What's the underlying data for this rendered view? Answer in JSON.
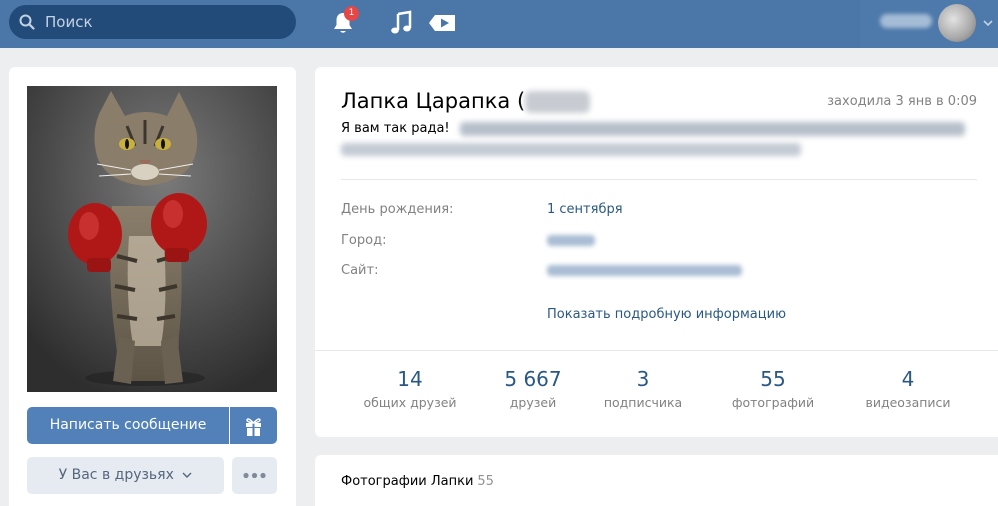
{
  "header": {
    "search_placeholder": "Поиск",
    "notifications_count": "1",
    "icons": [
      "search-icon",
      "bell-icon",
      "music-icon",
      "video-icon",
      "chevron-down-icon"
    ],
    "accent": "#4a76a8"
  },
  "profile": {
    "name": "Лапка Царапка (",
    "last_seen": "заходила 3 янв в 0:09",
    "status": "Я вам так рада! ",
    "info": {
      "birthday_label": "День рождения:",
      "birthday_value": "1 сентября",
      "city_label": "Город:",
      "site_label": "Сайт:",
      "show_more": "Показать подробную информацию"
    },
    "counters": [
      {
        "value": "14",
        "label": "общих друзей"
      },
      {
        "value": "5 667",
        "label": "друзей"
      },
      {
        "value": "3",
        "label": "подписчика"
      },
      {
        "value": "55",
        "label": "фотографий"
      },
      {
        "value": "4",
        "label": "видеозаписи"
      }
    ]
  },
  "actions": {
    "message_button": "Написать сообщение",
    "friends_button": "У Вас в друзьях",
    "primary_color": "#5181b8"
  },
  "photos": {
    "title": "Фотографии Лапки",
    "count": "55"
  }
}
